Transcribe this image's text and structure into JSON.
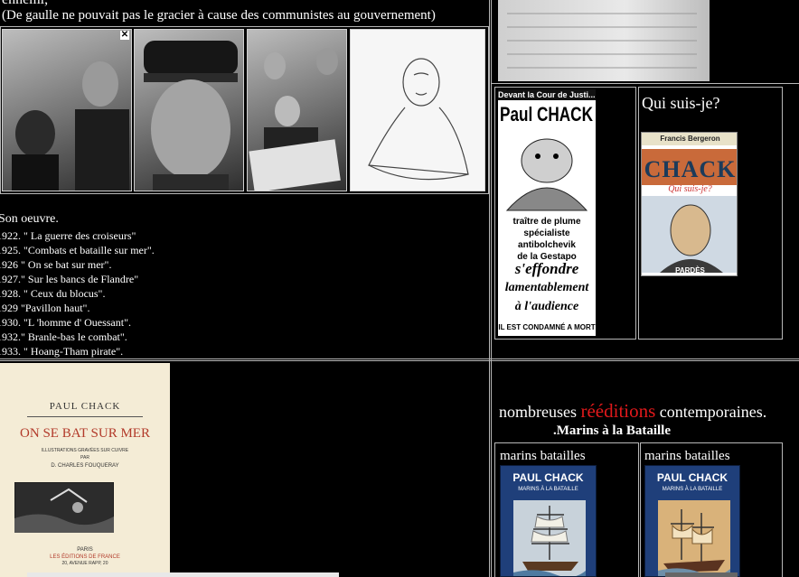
{
  "top_left": {
    "partial_line": "ennemi,",
    "caption": "(De gaulle ne pouvait pas le gracier à cause des communistes au gouvernement)"
  },
  "photos": [
    {
      "name": "photo-two-men",
      "icon": "close-icon",
      "close_glyph": "✕"
    },
    {
      "name": "photo-man-in-cap"
    },
    {
      "name": "photo-man-with-newspaper"
    },
    {
      "name": "photo-sketch-portrait"
    }
  ],
  "clipping": {
    "header": "Devant la Cour de Justi...",
    "name": "Paul CHACK",
    "lines": [
      "traître de plume",
      "spécialiste antibolchevik",
      "de la Gestapo"
    ],
    "headline": [
      "s'effondre",
      "lamentablement",
      "à l'audience"
    ],
    "footer": "IL EST CONDAMNÉ A MORT"
  },
  "qui_suis_je": {
    "title": "Qui suis-je?",
    "book_author": "Francis Bergeron",
    "book_title": "CHACK",
    "book_subtitle": "Qui suis-je?",
    "publisher": "PARDÈS"
  },
  "oeuvre": {
    "title": "Son oeuvre.",
    "items": [
      "1922. \" La guerre des croiseurs\"",
      "1925. \"Combats et bataille sur mer\".",
      "1926 \" On se bat sur mer\".",
      "1927.\" Sur les bancs de Flandre\"",
      "1928. \" Ceux du blocus\".",
      "1929 \"Pavillon haut\".",
      "1930. \"L 'homme d' Ouessant\".",
      "1932.\" Branle-bas le combat\".",
      "1933. \" Hoang-Tham pirate\"."
    ]
  },
  "book_cover": {
    "author": "PAUL CHACK",
    "title": "ON SE BAT SUR MER",
    "line1": "ILLUSTRATIONS GRAVÉES SUR CUIVRE",
    "line2": "PAR",
    "illustrator": "D. CHARLES FOUQUERAY",
    "city": "PARIS",
    "publisher": "LES ÉDITIONS DE FRANCE",
    "address": "20, AVENUE RAPP, 20"
  },
  "reeditions": {
    "before": "nombreuses",
    "highlight": "rééditions",
    "after": "contemporaines.",
    "subtitle": ".Marins à la Bataille",
    "highlight_color": "#e0191b"
  },
  "marins": [
    {
      "label": "marins batailles",
      "author": "PAUL CHACK",
      "title": "MARINS À LA BATAILLE"
    },
    {
      "label": "marins batailles",
      "author": "PAUL CHACK",
      "title": "MARINS À LA BATAILLE"
    }
  ]
}
